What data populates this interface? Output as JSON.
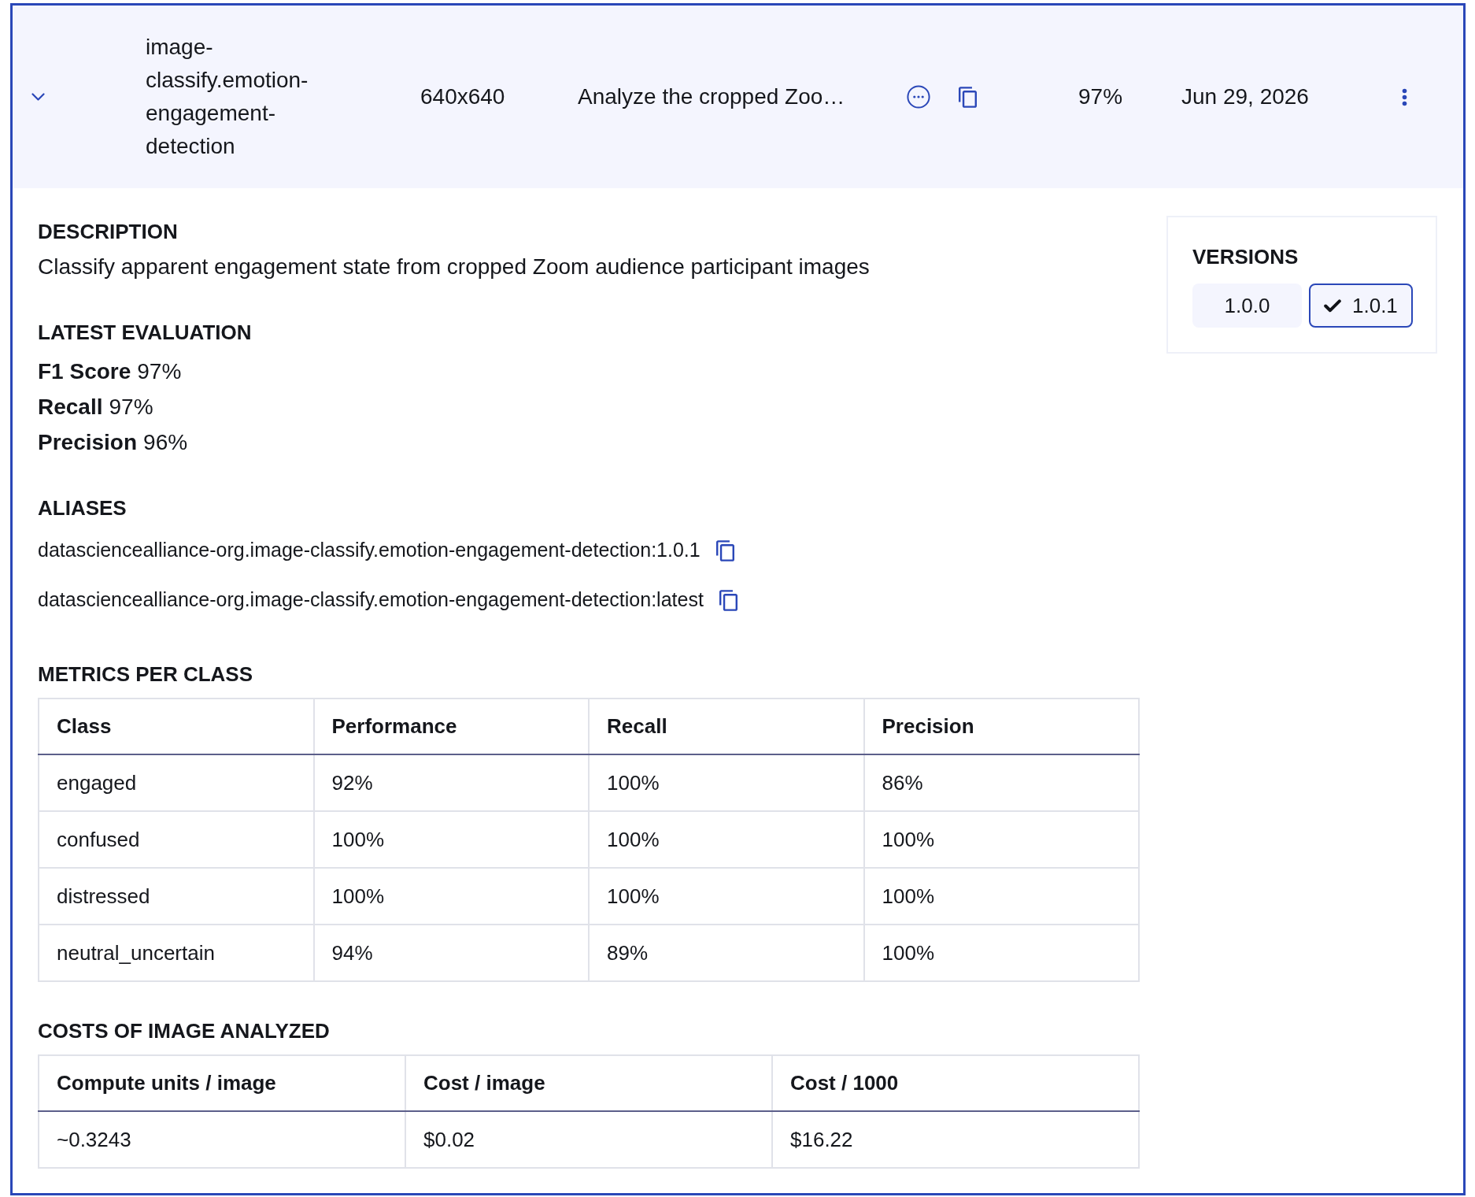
{
  "model_row": {
    "expanded": true,
    "name": "image-classify.emotion-engagement-detection",
    "resolution": "640x640",
    "prompt": "Analyze the cropped Zoo…",
    "score": "97%",
    "date": "Jun 29, 2026"
  },
  "details": {
    "description": {
      "heading": "DESCRIPTION",
      "text": "Classify apparent engagement state from cropped Zoom audience participant images"
    },
    "latest_evaluation": {
      "heading": "LATEST EVALUATION",
      "metrics": [
        {
          "label": "F1 Score",
          "value": "97%"
        },
        {
          "label": "Recall",
          "value": "97%"
        },
        {
          "label": "Precision",
          "value": "96%"
        }
      ]
    },
    "aliases": {
      "heading": "ALIASES",
      "items": [
        "datasciencealliance-org.image-classify.emotion-engagement-detection:1.0.1",
        "datasciencealliance-org.image-classify.emotion-engagement-detection:latest"
      ]
    },
    "metrics_per_class": {
      "heading": "METRICS PER CLASS",
      "columns": [
        "Class",
        "Performance",
        "Recall",
        "Precision"
      ],
      "rows": [
        [
          "engaged",
          "92%",
          "100%",
          "86%"
        ],
        [
          "confused",
          "100%",
          "100%",
          "100%"
        ],
        [
          "distressed",
          "100%",
          "100%",
          "100%"
        ],
        [
          "neutral_uncertain",
          "94%",
          "89%",
          "100%"
        ]
      ]
    },
    "costs": {
      "heading": "COSTS OF IMAGE ANALYZED",
      "columns": [
        "Compute units / image",
        "Cost / image",
        "Cost / 1000"
      ],
      "rows": [
        [
          "~0.3243",
          "$0.02",
          "$16.22"
        ]
      ]
    }
  },
  "versions": {
    "heading": "VERSIONS",
    "items": [
      {
        "label": "1.0.0",
        "selected": false
      },
      {
        "label": "1.0.1",
        "selected": true
      }
    ]
  }
}
